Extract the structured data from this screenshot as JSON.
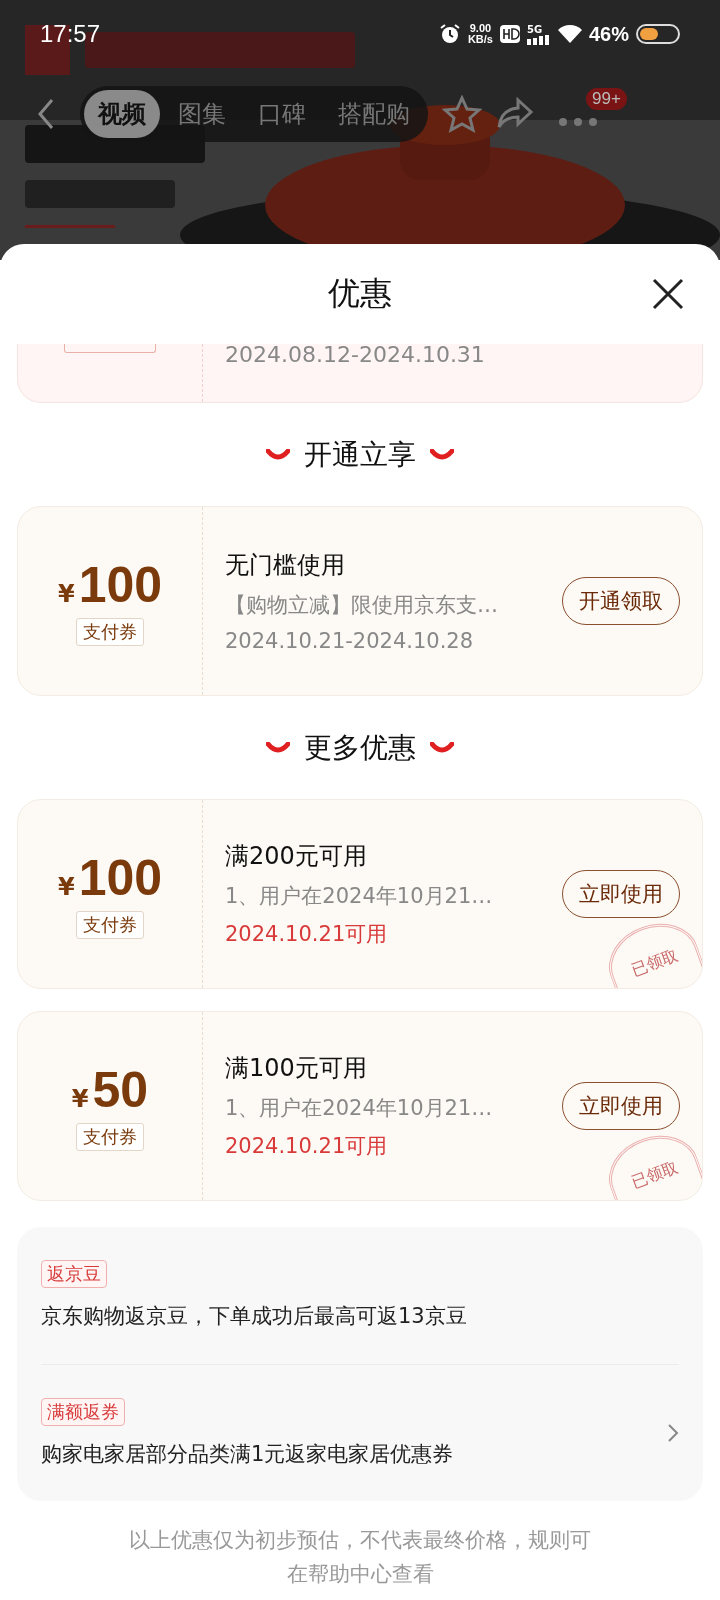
{
  "status_bar": {
    "time": "17:57",
    "speed_value": "9.00",
    "speed_unit": "KB/s",
    "network": "5G",
    "battery": "46%"
  },
  "nav": {
    "tabs": [
      {
        "label": "视频",
        "selected": true
      },
      {
        "label": "图集",
        "selected": false
      },
      {
        "label": "口碑",
        "selected": false
      },
      {
        "label": "搭配购",
        "selected": false
      }
    ],
    "badge": "99+"
  },
  "sheet": {
    "title": "优惠",
    "partial_coupon": {
      "date": "2024.08.12-2024.10.31"
    },
    "sections": [
      {
        "heading": "开通立享",
        "coupons": [
          {
            "currency": "¥",
            "amount": "100",
            "type": "支付券",
            "title": "无门槛使用",
            "desc": "【购物立减】限使用京东支…",
            "date": "2024.10.21-2024.10.28",
            "date_highlighted": false,
            "button": "开通领取"
          }
        ]
      },
      {
        "heading": "更多优惠",
        "coupons": [
          {
            "currency": "¥",
            "amount": "100",
            "type": "支付券",
            "title": "满200元可用",
            "desc": "1、用户在2024年10月21…",
            "date": "2024.10.21可用",
            "date_highlighted": true,
            "button": "立即使用",
            "stamp": "已领取"
          },
          {
            "currency": "¥",
            "amount": "50",
            "type": "支付券",
            "title": "满100元可用",
            "desc": "1、用户在2024年10月21…",
            "date": "2024.10.21可用",
            "date_highlighted": true,
            "button": "立即使用",
            "stamp": "已领取"
          }
        ]
      }
    ],
    "rebates": [
      {
        "tag": "返京豆",
        "text": "京东购物返京豆，下单成功后最高可返13京豆",
        "has_arrow": false
      },
      {
        "tag": "满额返券",
        "text": "购家电家居部分品类满1元返家电家居优惠券",
        "has_arrow": true
      }
    ],
    "footer_lines": [
      "以上优惠仅为初步预估，不代表最终价格，规则可",
      "在帮助中心查看"
    ]
  }
}
